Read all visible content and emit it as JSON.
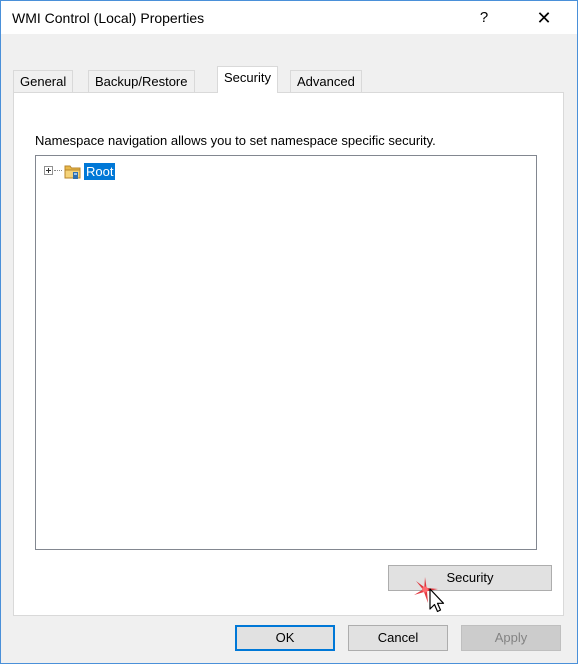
{
  "window": {
    "title": "WMI Control (Local) Properties",
    "help_glyph": "?",
    "close_glyph": "✕"
  },
  "tabs": [
    {
      "label": "General",
      "active": false
    },
    {
      "label": "Backup/Restore",
      "active": false
    },
    {
      "label": "Security",
      "active": true
    },
    {
      "label": "Advanced",
      "active": false
    }
  ],
  "security_tab": {
    "description": "Namespace navigation allows you to set namespace specific security.",
    "tree": {
      "root_label": "Root",
      "root_selected": true,
      "root_icon": "folder-icon"
    },
    "security_button_label": "Security"
  },
  "footer": {
    "ok_label": "OK",
    "cancel_label": "Cancel",
    "apply_label": "Apply",
    "apply_enabled": false
  },
  "colors": {
    "selection": "#0078d7",
    "window_border": "#4a90d9",
    "click_highlight": "#e0242b"
  }
}
